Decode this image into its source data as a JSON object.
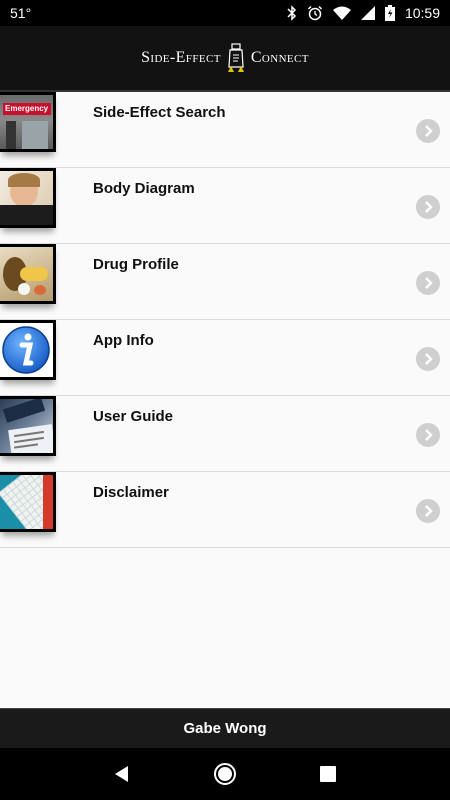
{
  "status_bar": {
    "temperature": "51°",
    "time": "10:59",
    "icons": [
      "bluetooth-icon",
      "alarm-icon",
      "wifi-icon",
      "signal-icon",
      "battery-icon"
    ]
  },
  "header": {
    "logo_left": "Side-Effect",
    "logo_right": "Connect"
  },
  "menu": {
    "items": [
      {
        "label": "Side-Effect Search",
        "thumb_text": "Emergency",
        "icon": "emergency-photo"
      },
      {
        "label": "Body Diagram",
        "icon": "child-photo"
      },
      {
        "label": "Drug Profile",
        "icon": "pills-photo"
      },
      {
        "label": "App Info",
        "icon": "info-icon"
      },
      {
        "label": "User Guide",
        "icon": "guide-photo"
      },
      {
        "label": "Disclaimer",
        "icon": "document-photo"
      }
    ]
  },
  "footer": {
    "name": "Gabe Wong"
  },
  "nav": {
    "icons": [
      "back-icon",
      "home-icon",
      "recents-icon"
    ]
  },
  "colors": {
    "header_bg": "#121212",
    "list_bg": "#fafafa",
    "chevron_bg": "#cfcfcf",
    "info_blue": "#1a6fd8"
  }
}
